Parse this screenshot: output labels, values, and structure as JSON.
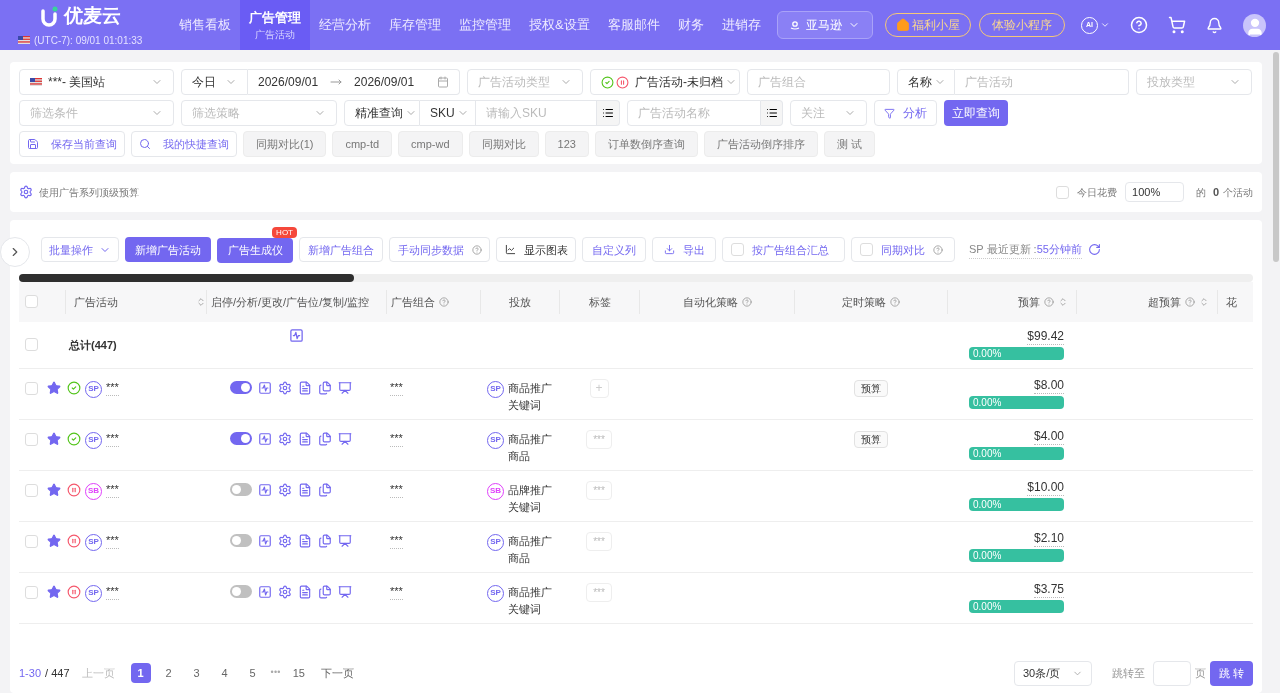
{
  "header": {
    "logo": "优麦云",
    "timezone": "(UTC-7): 09/01 01:01:33",
    "platform": "亚马逊",
    "welfare": "福利小屋",
    "miniapp": "体验小程序",
    "ai": "AI",
    "nav": [
      {
        "label": "销售看板",
        "selected": false
      },
      {
        "label": "广告管理",
        "sub": "广告活动",
        "selected": true
      },
      {
        "label": "经营分析",
        "selected": false
      },
      {
        "label": "库存管理",
        "selected": false
      },
      {
        "label": "监控管理",
        "selected": false
      },
      {
        "label": "授权&设置",
        "selected": false
      },
      {
        "label": "客服邮件",
        "selected": false
      },
      {
        "label": "财务",
        "selected": false
      },
      {
        "label": "进销存",
        "selected": false
      }
    ]
  },
  "filters": {
    "store": "***- 美国站",
    "period": "今日",
    "date_start": "2026/09/01",
    "date_end": "2026/09/01",
    "campaign_type_placeholder": "广告活动类型",
    "status": "广告活动-未归档",
    "ad_group_placeholder": "广告组合",
    "name_field": "名称",
    "campaign_placeholder": "广告活动",
    "targeting_type_placeholder": "投放类型",
    "condition_placeholder": "筛选条件",
    "strategy_placeholder": "筛选策略",
    "match": "精准查询",
    "sku_field": "SKU",
    "sku_placeholder": "请输入SKU",
    "campaign_name_placeholder": "广告活动名称",
    "follow_placeholder": "关注",
    "analyze": "分析",
    "query": "立即查询",
    "save_query": "保存当前查询",
    "my_queries": "我的快捷查询",
    "saved": [
      "同期对比(1)",
      "cmp-td",
      "cmp-wd",
      "同期对比",
      "123",
      "订单数倒序查询",
      "广告活动倒序排序",
      "测 试"
    ]
  },
  "budget_bar": {
    "label": "使用广告系列顶级预算",
    "spend_checked": false,
    "spend_label": "今日花费",
    "percent": "100%",
    "of": "的",
    "count": "0",
    "unit": "个活动"
  },
  "toolbar": {
    "batch": "批量操作",
    "new_campaign": "新增广告活动",
    "generator": "广告生成仪",
    "hot": "HOT",
    "new_group": "新增广告组合",
    "sync": "手动同步数据",
    "chart": "显示图表",
    "custom_columns": "自定义列",
    "export": "导出",
    "group_summary": {
      "label": "按广告组合汇总",
      "checked": false
    },
    "compare": {
      "label": "同期对比",
      "checked": false
    },
    "update_prefix": "SP 最近更新 :",
    "update_time": "55分钟前"
  },
  "table": {
    "columns": [
      {
        "label": "广告活动",
        "sortable": true,
        "help": false
      },
      {
        "label": "启停/分析/更改/广告位/复制/监控",
        "sortable": false,
        "help": false
      },
      {
        "label": "广告组合",
        "sortable": false,
        "help": true
      },
      {
        "label": "投放",
        "sortable": false,
        "help": false
      },
      {
        "label": "标签",
        "sortable": false,
        "help": false
      },
      {
        "label": "自动化策略",
        "sortable": false,
        "help": true
      },
      {
        "label": "定时策略",
        "sortable": false,
        "help": true
      },
      {
        "label": "预算",
        "sortable": true,
        "help": true
      },
      {
        "label": "超预算",
        "sortable": true,
        "help": true
      },
      {
        "label": "花",
        "sortable": false,
        "help": false
      }
    ],
    "all_checked": false,
    "total": {
      "label": "总计(447)",
      "checked": false,
      "budget": "$99.42",
      "share": "0.00%"
    },
    "rows": [
      {
        "checked": false,
        "starred": true,
        "enabled": true,
        "ad_type": "SP",
        "name": "***",
        "on": true,
        "monitor": true,
        "group": "***",
        "target_type": "SP",
        "target_line1": "商品推广",
        "target_line2": "关键词",
        "add_tag": "+",
        "schedule": "预算",
        "budget": "$8.00",
        "share": "0.00%"
      },
      {
        "checked": false,
        "starred": true,
        "enabled": true,
        "ad_type": "SP",
        "name": "***",
        "on": true,
        "monitor": true,
        "group": "***",
        "target_type": "SP",
        "target_line1": "商品推广",
        "target_line2": "商品",
        "tag": "***",
        "schedule": "预算",
        "budget": "$4.00",
        "share": "0.00%"
      },
      {
        "checked": false,
        "starred": true,
        "enabled": false,
        "ad_type": "SB",
        "name": "***",
        "on": false,
        "monitor": false,
        "group": "***",
        "target_type": "SB",
        "target_line1": "品牌推广",
        "target_line2": "关键词",
        "tag": "***",
        "budget": "$10.00",
        "share": "0.00%"
      },
      {
        "checked": false,
        "starred": true,
        "enabled": false,
        "ad_type": "SP",
        "name": "***",
        "on": false,
        "monitor": true,
        "group": "***",
        "target_type": "SP",
        "target_line1": "商品推广",
        "target_line2": "商品",
        "tag": "***",
        "budget": "$2.10",
        "share": "0.00%"
      },
      {
        "checked": false,
        "starred": true,
        "enabled": false,
        "ad_type": "SP",
        "name": "***",
        "on": false,
        "monitor": true,
        "group": "***",
        "target_type": "SP",
        "target_line1": "商品推广",
        "target_line2": "关键词",
        "tag": "***",
        "budget": "$3.75",
        "share": "0.00%"
      }
    ]
  },
  "pagination": {
    "range": "1-30",
    "total": "/ 447",
    "prev": "上一页",
    "next": "下一页",
    "pages": [
      {
        "kind": "page",
        "label": "1",
        "selected": true
      },
      {
        "kind": "page",
        "label": "2",
        "selected": false
      },
      {
        "kind": "page",
        "label": "3",
        "selected": false
      },
      {
        "kind": "page",
        "label": "4",
        "selected": false
      },
      {
        "kind": "page",
        "label": "5",
        "selected": false
      },
      {
        "kind": "ellipsis",
        "label": "•••"
      },
      {
        "kind": "page",
        "label": "15",
        "selected": false
      }
    ],
    "page_size": "30条/页",
    "jump_label": "跳转至",
    "page_unit": "页",
    "jump": "跳 转"
  }
}
